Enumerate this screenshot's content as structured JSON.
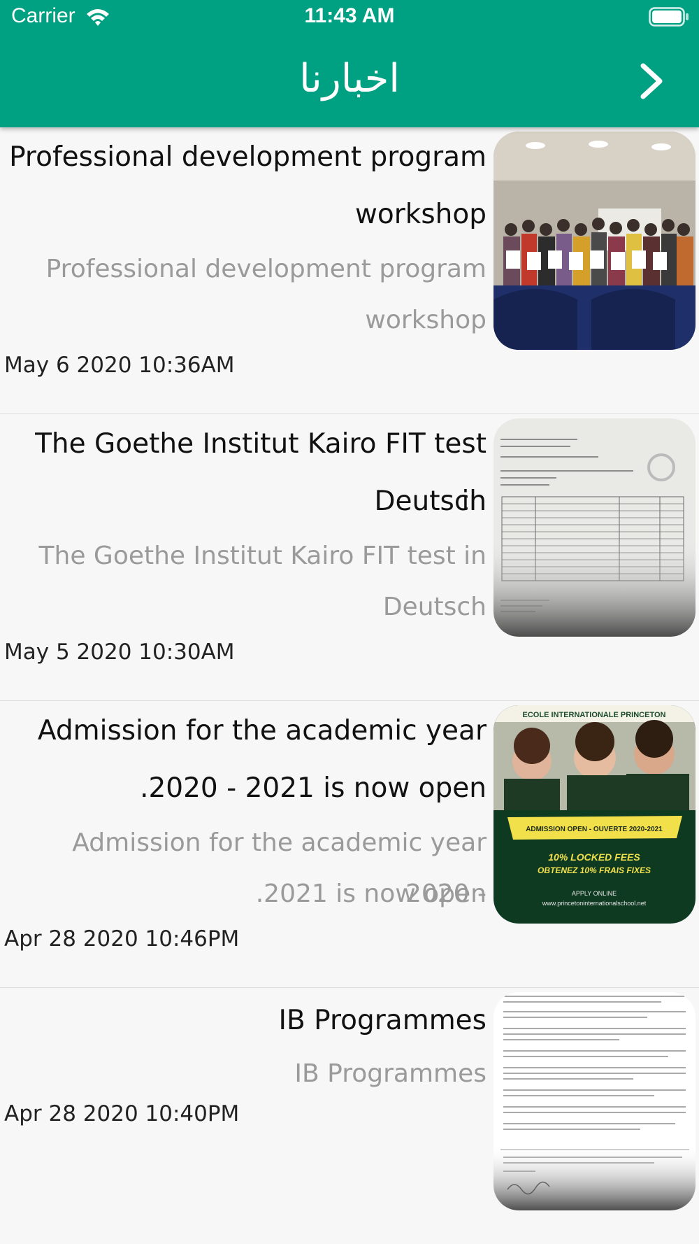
{
  "status_bar": {
    "carrier": "Carrier",
    "time": "11:43 AM",
    "wifi_icon": "wifi-icon",
    "battery_icon": "battery-icon"
  },
  "nav": {
    "title": "اخبارنا",
    "back_icon": "chevron-right-icon"
  },
  "colors": {
    "brand": "#00a082",
    "title_text": "#111111",
    "subtitle_text": "#9a9a9a",
    "background": "#f7f7f7"
  },
  "news": [
    {
      "title_line1": "Professional development program",
      "title_line2": "workshop",
      "subtitle_line1": "Professional development program",
      "subtitle_line2": "workshop",
      "date": "May  6 2020 10:36AM",
      "thumbnail_icon": "group-photo-thumbnail"
    },
    {
      "title_line1": "The Goethe Institut Kairo FIT test in",
      "title_line2": "Deutsch",
      "subtitle_line1": "The Goethe Institut Kairo FIT test in",
      "subtitle_line2": "Deutsch",
      "date": "May  5 2020 10:30AM",
      "thumbnail_icon": "document-thumbnail"
    },
    {
      "title_line1": "Admission for the academic year",
      "title_line2": ".2020 - 2021 is now open",
      "subtitle_line1": "Admission for the academic year 2020 -",
      "subtitle_line2": ".2021 is now open",
      "date": "Apr 28 2020 10:46PM",
      "thumbnail_icon": "admission-poster-thumbnail",
      "poster": {
        "school": "ECOLE INTERNATIONALE PRINCETON",
        "banner": "ADMISSION OPEN - OUVERTE 2020-2021",
        "offer_line1": "10% LOCKED FEES",
        "offer_line2": "OBTENEZ 10% FRAIS FIXES",
        "apply": "APPLY ONLINE",
        "url": "www.princetoninternationalschool.net"
      }
    },
    {
      "title_line1": "IB Programmes",
      "subtitle_line1": "IB Programmes",
      "date": "Apr 28 2020 10:40PM",
      "thumbnail_icon": "letter-thumbnail"
    }
  ]
}
